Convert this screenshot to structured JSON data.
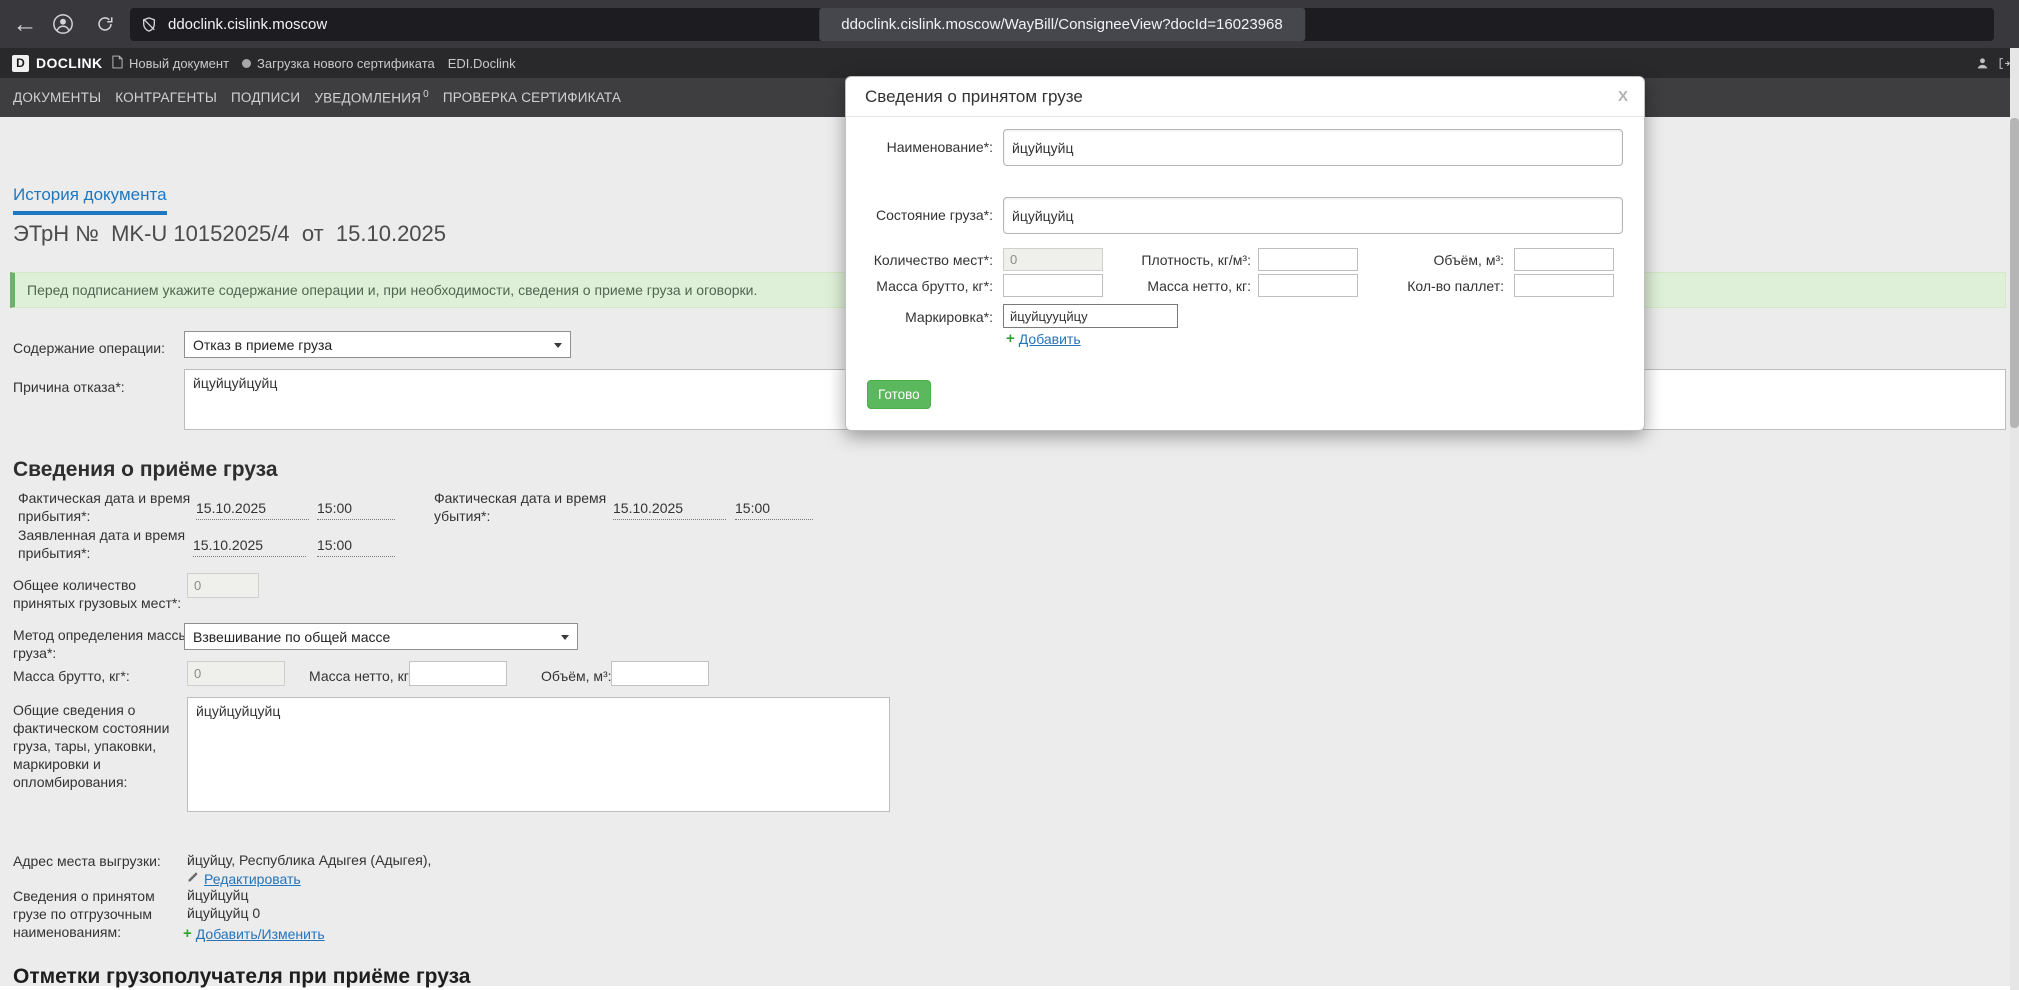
{
  "colors": {
    "accent_blue": "#1d78c1",
    "link_blue": "#2673b8",
    "success_green": "#5cb85c",
    "alert_green_bg": "#dff0d8"
  },
  "browser": {
    "url_domain": "ddoclink.cislink.moscow",
    "url_full": "ddoclink.cislink.moscow/WayBill/ConsigneeView?docId=16023968"
  },
  "app_header": {
    "logo_letter": "D",
    "logo_text": "DOCLINK",
    "menu": [
      {
        "label": "Новый документ"
      },
      {
        "label": "Загрузка нового сертификата"
      },
      {
        "label": "EDI.Doclink"
      }
    ]
  },
  "nav": {
    "items": [
      {
        "label": "ДОКУМЕНТЫ"
      },
      {
        "label": "КОНТРАГЕНТЫ"
      },
      {
        "label": "ПОДПИСИ"
      },
      {
        "label": "УВЕДОМЛЕНИЯ",
        "badge": "0"
      },
      {
        "label": "ПРОВЕРКА СЕРТИФИКАТА"
      }
    ]
  },
  "page": {
    "history_tab": "История документа",
    "doc_title": "ЭТрН №  MK-U 10152025/4  от  15.10.2025",
    "alert_text": "Перед подписанием укажите содержание операции и, при необходимости, сведения о приеме груза и оговорки.",
    "operation_label": "Содержание операции:",
    "operation_value": "Отказ в приеме груза",
    "refusal_label": "Причина отказа*:",
    "refusal_value": "йцуйцуйцуйц",
    "section_heading": "Сведения о приёме груза",
    "actual_arrival_label": "Фактическая дата и время прибытия*:",
    "actual_arrival_date": "15.10.2025",
    "actual_arrival_time": "15:00",
    "actual_departure_label": "Фактическая дата и время убытия*:",
    "actual_departure_date": "15.10.2025",
    "actual_departure_time": "15:00",
    "declared_arrival_label": "Заявленная дата и время прибытия*:",
    "declared_arrival_date": "15.10.2025",
    "declared_arrival_time": "15:00",
    "total_places_label": "Общее количество принятых грузовых мест*:",
    "total_places_value": "0",
    "mass_method_label": "Метод определения массы груза*:",
    "mass_method_value": "Взвешивание по общей массе",
    "gross_label": "Масса брутто, кг*:",
    "gross_value": "0",
    "net_label": "Масса нетто, кг:",
    "net_value": "",
    "volume_label": "Объём, м³:",
    "volume_value": "",
    "condition_label": "Общие сведения о фактическом состоянии груза, тары, упаковки, маркировки и опломбирования:",
    "condition_value": "йцуйцуйцуйц",
    "address_label": "Адрес места выгрузки:",
    "address_value": "йцуйцу, Республика Адыгея (Адыгея),",
    "edit_link": "Редактировать",
    "cargo_label": "Сведения о принятом грузе по отгрузочным наименованиям:",
    "cargo_line1": "йцуйцуйц",
    "cargo_line2": "йцуйцуйц 0",
    "add_change_link": "Добавить/Изменить",
    "bottom_heading": "Отметки грузополучателя при приёме груза"
  },
  "modal": {
    "title": "Сведения о принятом грузе",
    "close_label": "X",
    "name_label": "Наименование*:",
    "name_value": "йцуйцуйц",
    "state_label": "Состояние груза*:",
    "state_value": "йцуйцуйц",
    "places_label": "Количество мест*:",
    "places_value": "0",
    "density_label": "Плотность, кг/м³:",
    "density_value": "",
    "volume_label": "Объём, м³:",
    "volume_value": "",
    "gross_label": "Масса брутто, кг*:",
    "gross_value": "",
    "net_label": "Масса нетто, кг:",
    "net_value": "",
    "pallets_label": "Кол-во паллет:",
    "pallets_value": "",
    "marking_label": "Маркировка*:",
    "marking_value": "йцуйцууцйцу",
    "add_link": "Добавить",
    "done_button": "Готово"
  }
}
